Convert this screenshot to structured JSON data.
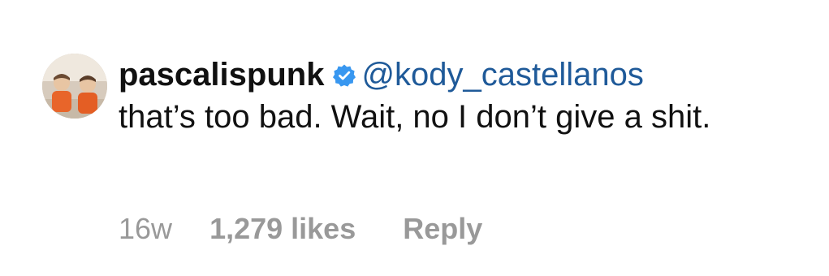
{
  "comment": {
    "avatar_icon": "profile-photo-two-children-orange-shirts",
    "username": "pascalispunk",
    "verified_icon": "verified-badge-icon",
    "mention": "@kody_castellanos",
    "text": "that’s too bad. Wait, no I don’t give a shit.",
    "timestamp": "16w",
    "likes": "1,279 likes",
    "reply_label": "Reply"
  },
  "colors": {
    "username": "#111111",
    "mention": "#1f5a99",
    "meta": "#999999",
    "verified_badge": "#3897f0"
  }
}
